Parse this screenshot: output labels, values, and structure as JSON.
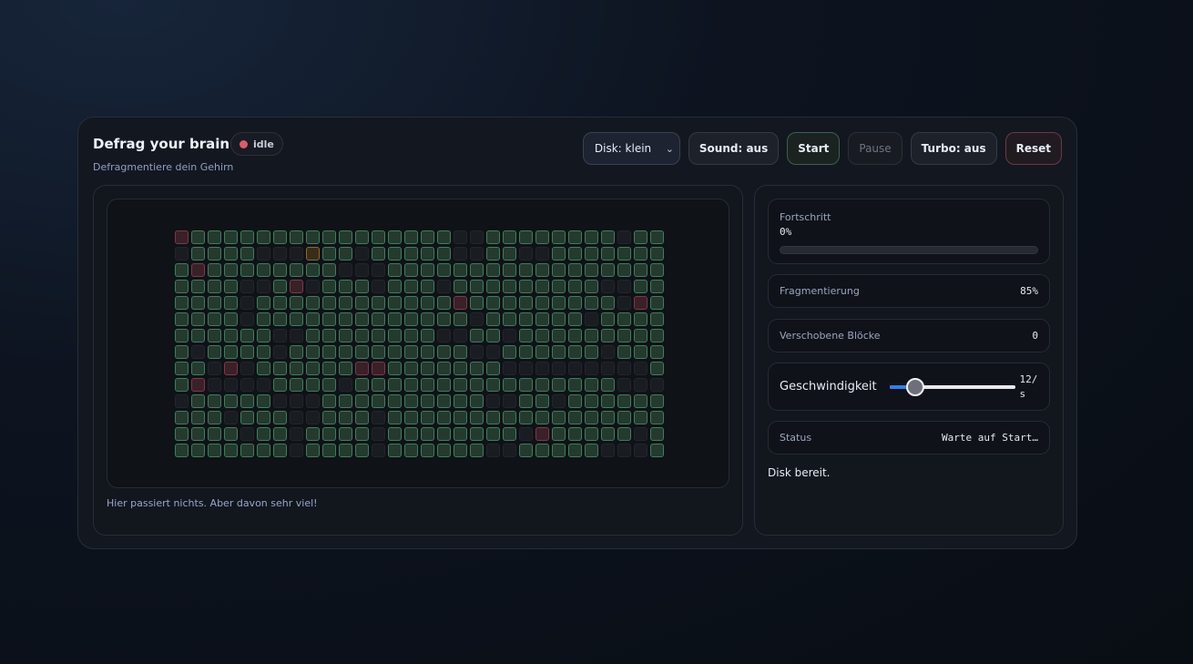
{
  "header": {
    "title": "Defrag your brain",
    "status_badge": "idle",
    "subtitle": "Defragmentiere dein Gehirn"
  },
  "toolbar": {
    "disk_select": {
      "selected": "Disk: klein"
    },
    "sound_label": "Sound: aus",
    "start_label": "Start",
    "pause_label": "Pause",
    "turbo_label": "Turbo: aus",
    "reset_label": "Reset"
  },
  "disk": {
    "rows": [
      "bUUUUUUUUUUUUUUUUffUUUUUUUUfUU",
      "fUUUUfffaUUfUUUUUffUUffUUUUUUU",
      "UbUUUUUUUUfffUUUUUUUUUUUUUUUUU",
      "UUUUffUbfUUUfUUUfUUUUUUUUUffUU",
      "UUUUfUUUUUUUUUUUUbUUUUUUUUUfbU",
      "UUUUfUUUUUUUUUUUUUfUUUUUUfUUUU",
      "UUUUUUffUUUUUUUUffUUfUUUUUUUUU",
      "UfUUUUfUUUUUUUUUUUffUUUUUUfUUU",
      "UUfbfUUUUUUbbUUUUUUUfffffffffU",
      "UbffffUUUUfUUUUUUUUUUUUUUUUfff",
      "fUUUUUfffUUUUUUUUUUffUUfUUUUUU",
      "UUUfUUUffUUUfUUUUUUUUUUUUUUUUU",
      "UUUUfUUfUUUUfUUUUUUUUfbUUUUUfU",
      "UUUUUUUfUUUUfUUUUUUffUUUUUfffU"
    ],
    "caption": "Hier passiert nichts. Aber davon sehr viel!"
  },
  "stats": {
    "progress_label": "Fortschritt",
    "progress_value": "0%",
    "progress_fraction": 0,
    "fragmentation_label": "Fragmentierung",
    "fragmentation_value": "85%",
    "moved_label": "Verschobene Blöcke",
    "moved_value": "0",
    "speed_label": "Geschwindigkeit",
    "speed_value": "12/s",
    "speed_level": 12,
    "status_label": "Status",
    "status_value": "Warte auf Start…",
    "message": "Disk bereit."
  },
  "colors": {
    "used_block": "#3f7d5c",
    "bad_block": "#7a3a48",
    "active_block": "#8a6a2c",
    "accent": "#2f7ff0"
  }
}
